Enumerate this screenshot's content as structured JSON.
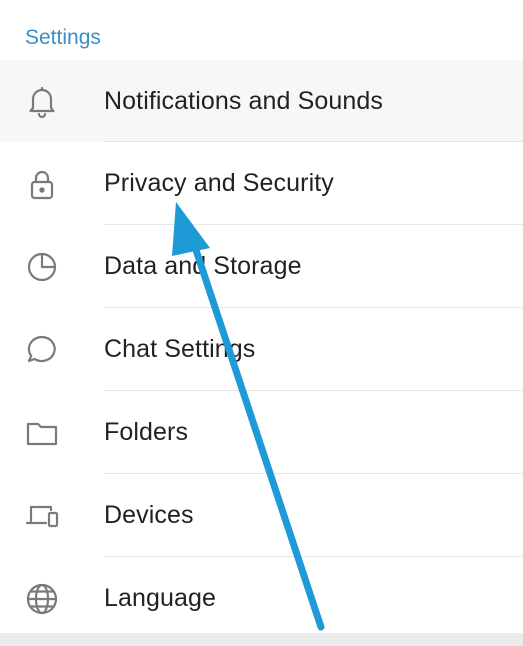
{
  "settings": {
    "section_title": "Settings",
    "items": [
      {
        "label": "Notifications and Sounds",
        "icon": "bell-icon"
      },
      {
        "label": "Privacy and Security",
        "icon": "lock-icon"
      },
      {
        "label": "Data and Storage",
        "icon": "pie-chart-icon"
      },
      {
        "label": "Chat Settings",
        "icon": "chat-bubble-icon"
      },
      {
        "label": "Folders",
        "icon": "folder-icon"
      },
      {
        "label": "Devices",
        "icon": "devices-icon"
      },
      {
        "label": "Language",
        "icon": "globe-icon"
      }
    ]
  },
  "colors": {
    "accent": "#3a8fc4",
    "annotation_arrow": "#1e9ad6",
    "icon_stroke": "#7a7a7a"
  }
}
